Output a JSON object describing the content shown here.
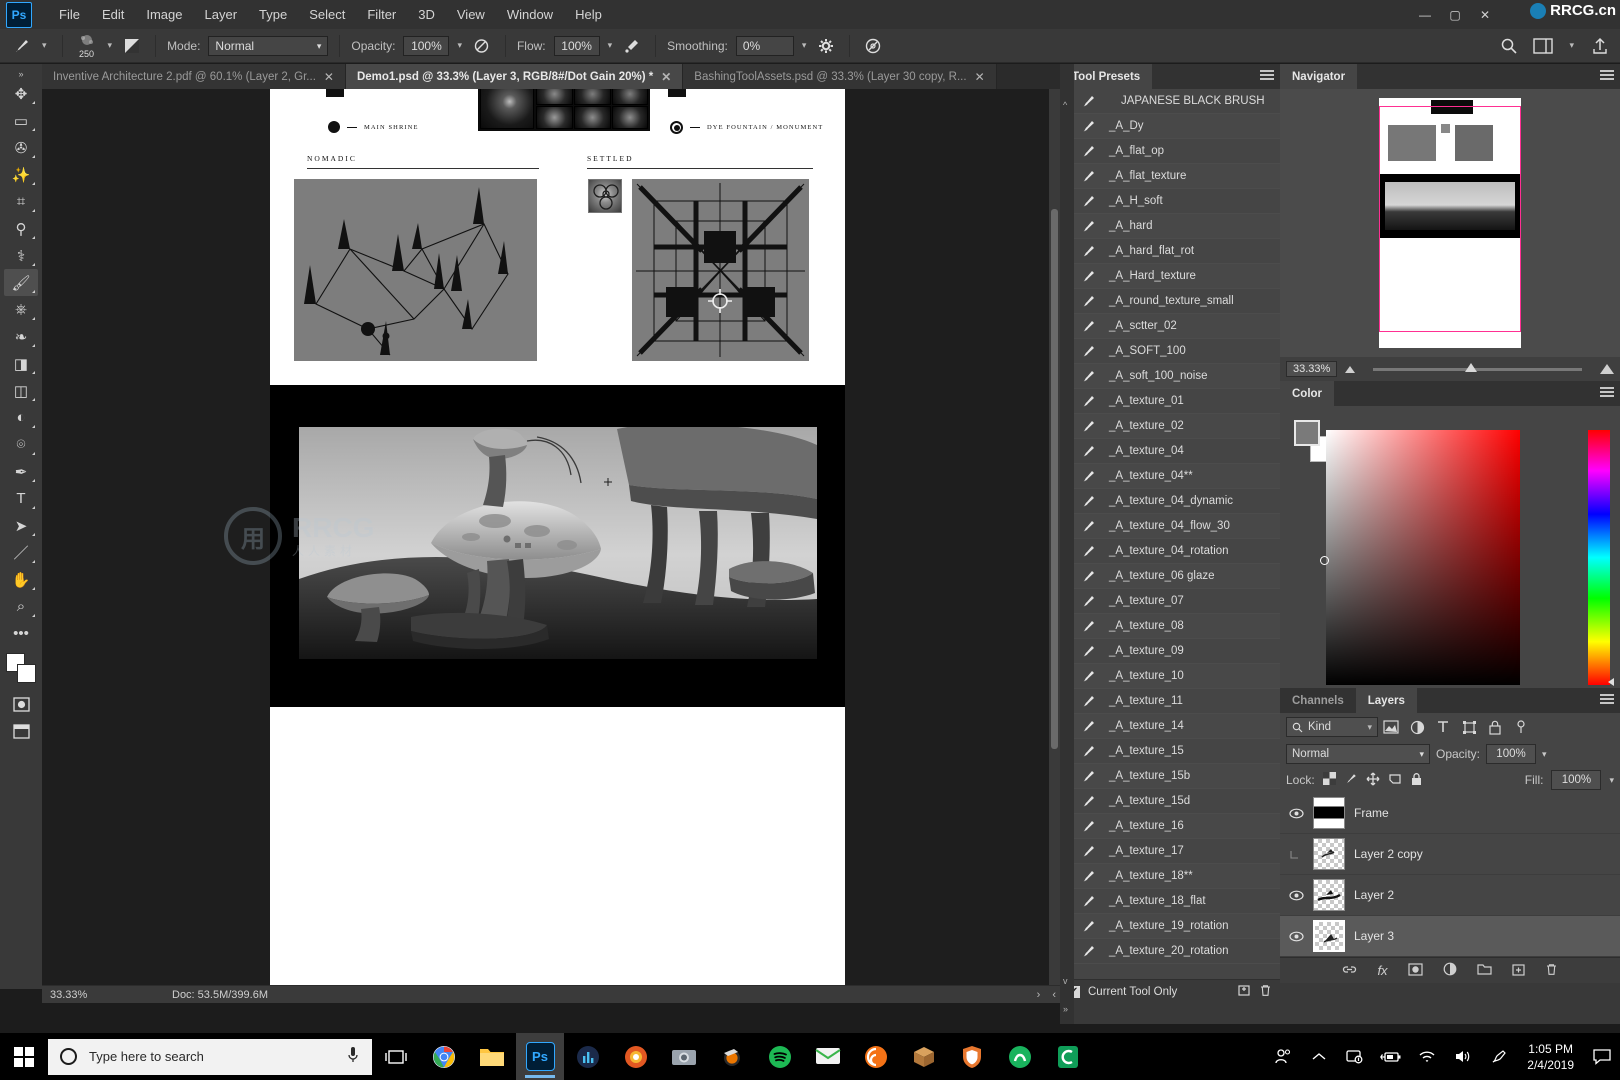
{
  "app": {
    "name": "Adobe Photoshop",
    "logo_text": "Ps",
    "watermark_text": "RRCG",
    "watermark_sub": "人人素材",
    "brand_site": "RRCG.cn"
  },
  "menubar": {
    "items": [
      "File",
      "Edit",
      "Image",
      "Layer",
      "Type",
      "Select",
      "Filter",
      "3D",
      "View",
      "Window",
      "Help"
    ],
    "window_controls": [
      "minimize",
      "maximize",
      "close"
    ]
  },
  "options_bar": {
    "tool_icon": "brush-icon",
    "brush_size": "250",
    "mode_label": "Mode:",
    "mode_value": "Normal",
    "opacity_label": "Opacity:",
    "opacity_value": "100%",
    "flow_label": "Flow:",
    "flow_value": "100%",
    "smoothing_label": "Smoothing:",
    "smoothing_value": "0%",
    "right_icons": [
      "search-icon",
      "workspace-icon",
      "chevron-down-icon",
      "share-icon"
    ]
  },
  "document_tabs": [
    {
      "label": "Inventive Architecture 2.pdf @ 60.1% (Layer 2, Gr...",
      "active": false
    },
    {
      "label": "Demo1.psd @ 33.3% (Layer 3, RGB/8#/Dot Gain 20%) *",
      "active": true
    },
    {
      "label": "BashingToolAssets.psd @ 33.3% (Layer 30 copy, R...",
      "active": false
    }
  ],
  "toolbar": {
    "tools": [
      {
        "name": "move-tool",
        "glyph": "✥",
        "selected": false
      },
      {
        "name": "marquee-tool",
        "glyph": "▭",
        "selected": false
      },
      {
        "name": "lasso-tool",
        "glyph": "✇",
        "selected": false
      },
      {
        "name": "quick-select-tool",
        "glyph": "✨",
        "selected": false
      },
      {
        "name": "crop-tool",
        "glyph": "⌗",
        "selected": false
      },
      {
        "name": "eyedropper-tool",
        "glyph": "⚲",
        "selected": false
      },
      {
        "name": "healing-brush-tool",
        "glyph": "⚕",
        "selected": false
      },
      {
        "name": "brush-tool",
        "glyph": "🖌",
        "selected": true
      },
      {
        "name": "clone-stamp-tool",
        "glyph": "⎈",
        "selected": false
      },
      {
        "name": "history-brush-tool",
        "glyph": "❧",
        "selected": false
      },
      {
        "name": "eraser-tool",
        "glyph": "◨",
        "selected": false
      },
      {
        "name": "gradient-tool",
        "glyph": "◫",
        "selected": false
      },
      {
        "name": "blur-tool",
        "glyph": "◐",
        "selected": false
      },
      {
        "name": "dodge-tool",
        "glyph": "⌾",
        "selected": false
      },
      {
        "name": "pen-tool",
        "glyph": "✒",
        "selected": false
      },
      {
        "name": "type-tool",
        "glyph": "T",
        "selected": false
      },
      {
        "name": "path-selection-tool",
        "glyph": "➤",
        "selected": false
      },
      {
        "name": "line-shape-tool",
        "glyph": "／",
        "selected": false
      },
      {
        "name": "hand-tool",
        "glyph": "✋",
        "selected": false
      },
      {
        "name": "zoom-tool",
        "glyph": "⌕",
        "selected": false
      },
      {
        "name": "more-tools",
        "glyph": "•••",
        "selected": false
      }
    ],
    "foreground_color": "#ffffff",
    "background_color": "#ffffff",
    "bottom_icons": [
      "quick-mask-icon",
      "screen-mode-icon"
    ]
  },
  "canvas": {
    "document_name": "Demo1.psd",
    "sheet": {
      "legend_left_label": "MAIN SHRINE",
      "legend_right_label": "DYE FOUNTAIN / MONUMENT",
      "section_left_title": "NOMADIC",
      "section_right_title": "SETTLED"
    }
  },
  "document_status": {
    "zoom": "33.33%",
    "doc_info": "Doc: 53.5M/399.6M"
  },
  "tool_presets": {
    "tab_label": "Tool Presets",
    "items": [
      "JAPANESE BLACK BRUSH",
      "_A_Dy",
      "_A_flat_op",
      "_A_flat_texture",
      "_A_H_soft",
      "_A_hard",
      "_A_hard_flat_rot",
      "_A_Hard_texture",
      "_A_round_texture_small",
      "_A_sctter_02",
      "_A_SOFT_100",
      "_A_soft_100_noise",
      "_A_texture_01",
      "_A_texture_02",
      "_A_texture_04",
      "_A_texture_04**",
      "_A_texture_04_dynamic",
      "_A_texture_04_flow_30",
      "_A_texture_04_rotation",
      "_A_texture_06 glaze",
      "_A_texture_07",
      "_A_texture_08",
      "_A_texture_09",
      "_A_texture_10",
      "_A_texture_11",
      "_A_texture_14",
      "_A_texture_15",
      "_A_texture_15b",
      "_A_texture_15d",
      "_A_texture_16",
      "_A_texture_17",
      "_A_texture_18**",
      "_A_texture_18_flat",
      "_A_texture_19_rotation",
      "_A_texture_20_rotation"
    ],
    "footer": {
      "current_tool_only_label": "Current Tool Only",
      "current_tool_only_checked": "✔",
      "new_preset_icon": "new-preset-icon",
      "delete_preset_icon": "trash-icon"
    }
  },
  "navigator": {
    "tab_label": "Navigator",
    "zoom_value": "33.33%",
    "view_rect_color": "#ff2f92"
  },
  "color_panel": {
    "tab_label": "Color",
    "foreground": "#7a7a7a",
    "background": "#ffffff"
  },
  "layers_panel": {
    "tabs": [
      {
        "label": "Layers",
        "active": true
      },
      {
        "label": "Channels",
        "active": false
      }
    ],
    "filter": {
      "kind_label": "Kind",
      "search_icon": "search-icon",
      "type_filters": [
        "pixel-filter-icon",
        "adjustment-filter-icon",
        "type-filter-icon",
        "shape-filter-icon",
        "smart-object-filter-icon",
        "filter-toggle-icon"
      ]
    },
    "blend_mode": "Normal",
    "opacity_label": "Opacity:",
    "opacity_value": "100%",
    "lock_label": "Lock:",
    "lock_icons": [
      "lock-transparency-icon",
      "lock-image-icon",
      "lock-position-icon",
      "lock-artboard-icon",
      "lock-all-icon"
    ],
    "fill_label": "Fill:",
    "fill_value": "100%",
    "layers": [
      {
        "name": "Frame",
        "visible": true,
        "selected": false
      },
      {
        "name": "Layer 2 copy",
        "visible": false,
        "selected": false
      },
      {
        "name": "Layer 2",
        "visible": true,
        "selected": false
      },
      {
        "name": "Layer 3",
        "visible": true,
        "selected": true
      }
    ],
    "footer_icons": [
      "link-layers-icon",
      "layer-style-icon",
      "layer-mask-icon",
      "adjustment-layer-icon",
      "new-group-icon",
      "new-layer-icon",
      "delete-layer-icon"
    ]
  },
  "taskbar": {
    "start_icon": "windows-start-icon",
    "search_placeholder": "Type here to search",
    "mic_icon": "microphone-icon",
    "task_view_icon": "task-view-icon",
    "apps": [
      {
        "name": "chrome",
        "label": "",
        "color": "#4285f4",
        "active": false
      },
      {
        "name": "file-explorer",
        "label": "",
        "color": "#ffb900",
        "active": false
      },
      {
        "name": "photoshop",
        "label": "Ps",
        "color": "#001e36",
        "active": true
      },
      {
        "name": "media-app",
        "label": "",
        "color": "#2d6fbd",
        "active": false
      },
      {
        "name": "firefox-dev",
        "label": "",
        "color": "#e25822",
        "active": false
      },
      {
        "name": "camera-app",
        "label": "",
        "color": "#8e8e8e",
        "active": false
      },
      {
        "name": "blender",
        "label": "",
        "color": "#ea7600",
        "active": false
      },
      {
        "name": "spotify",
        "label": "",
        "color": "#1db954",
        "active": false
      },
      {
        "name": "messaging",
        "label": "",
        "color": "#39b54a",
        "active": false
      },
      {
        "name": "houdini",
        "label": "",
        "color": "#f47216",
        "active": false
      },
      {
        "name": "package-app",
        "label": "",
        "color": "#b5651d",
        "active": false
      },
      {
        "name": "shield-app",
        "label": "",
        "color": "#e8772e",
        "active": false
      },
      {
        "name": "substance-app",
        "label": "",
        "color": "#39b54a",
        "active": false
      },
      {
        "name": "cinema4d",
        "label": "",
        "color": "#0f9d58",
        "active": false
      }
    ],
    "tray_icons": [
      "people-icon",
      "show-hidden-icons-icon",
      "onedrive-icon",
      "battery-icon",
      "wifi-icon",
      "volume-icon",
      "pen-icon"
    ],
    "clock_time": "1:05 PM",
    "clock_date": "2/4/2019",
    "notification_icon": "notification-icon"
  }
}
